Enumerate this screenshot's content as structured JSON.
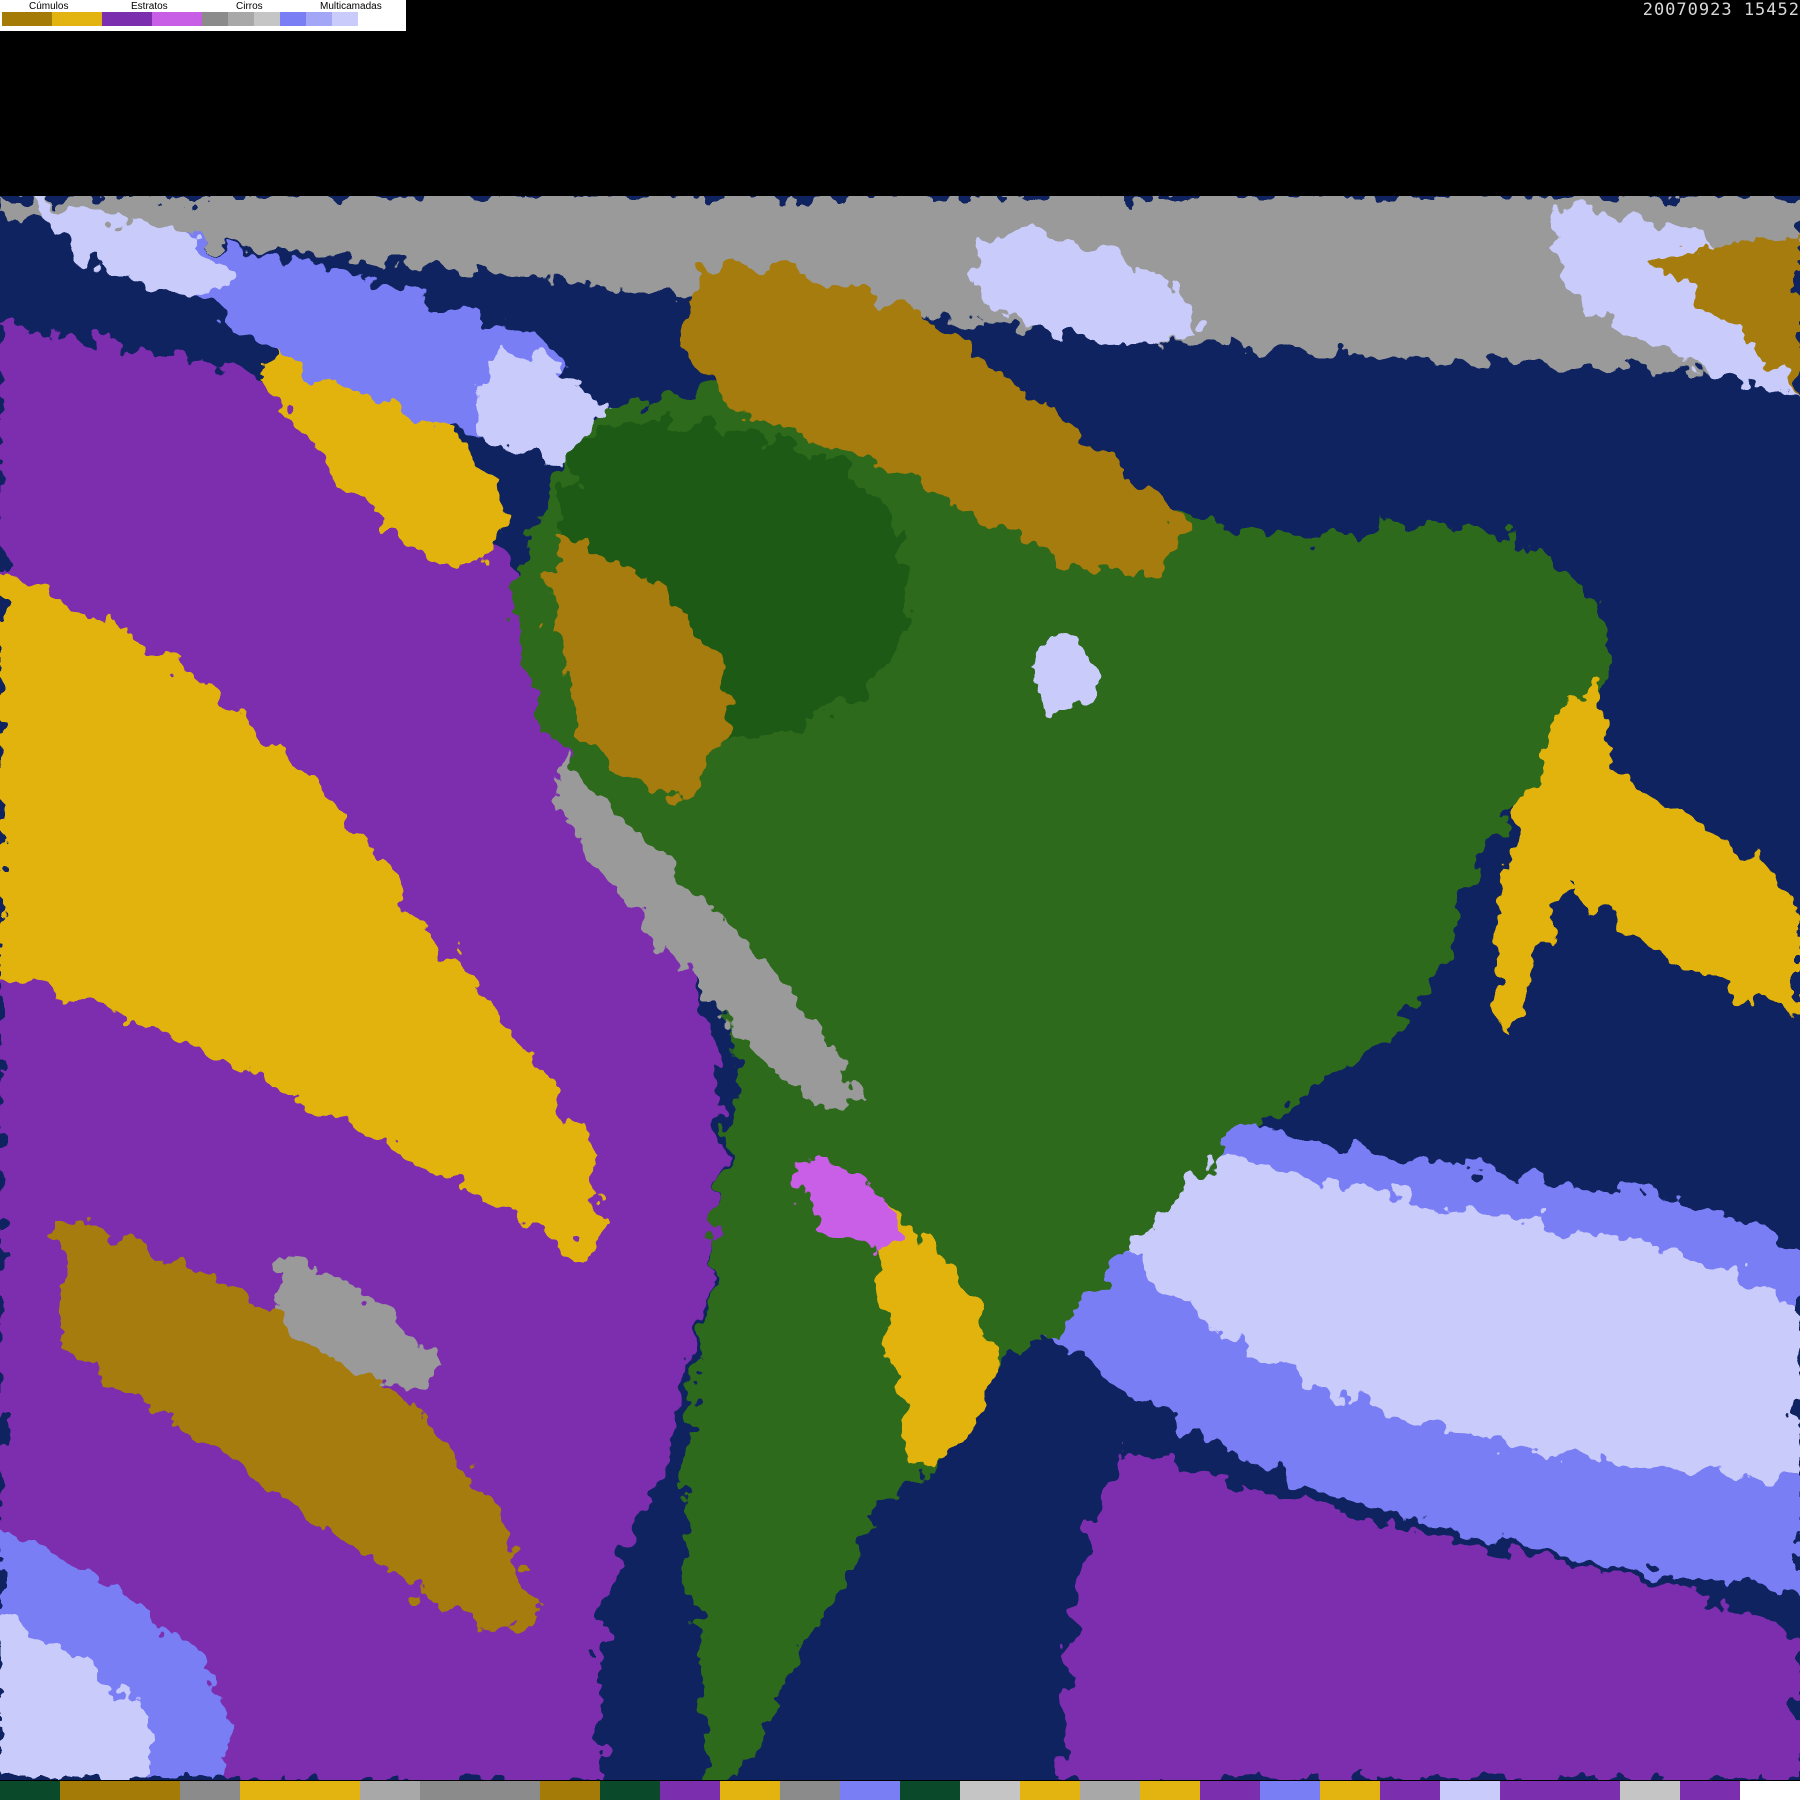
{
  "timestamp": "20070923 15452",
  "legend": {
    "groups": [
      {
        "label": "Cúmulos"
      },
      {
        "label": "Estratos"
      },
      {
        "label": "Cirros"
      },
      {
        "label": "Multicamadas"
      }
    ],
    "swatch_colors": [
      "#a57b07",
      "#e3b30f",
      "#7b2fae",
      "#c95ee6",
      "#8b8b8b",
      "#a8a8a8",
      "#c5c5c5",
      "#7a7ef4",
      "#a3a6f6",
      "#c9ccfb",
      "#ffffff"
    ]
  },
  "map_colors": {
    "ocean": "#0f2360",
    "land": "#2f6b1f",
    "land_dark": "#1d5a14",
    "cumulus_dark": "#a57b07",
    "cumulus": "#e3b30f",
    "stratus": "#7b2fae",
    "stratus_light": "#c95ee6",
    "cirrus": "#9a9a9a",
    "multilayer": "#7a7ef4",
    "multilayer_light": "#c9ccfb"
  },
  "bottom_strip_colors": [
    "#0a4a2a",
    "#a57b07",
    "#a57b07",
    "#8b8b8b",
    "#e3b30f",
    "#e3b30f",
    "#a8a8a8",
    "#8b8b8b",
    "#8b8b8b",
    "#a57b07",
    "#0a4a2a",
    "#7b2fae",
    "#e3b30f",
    "#8b8b8b",
    "#7a7ef4",
    "#0a4a2a",
    "#c5c5c5",
    "#e3b30f",
    "#a8a8a8",
    "#e3b30f",
    "#7b2fae",
    "#7a7ef4",
    "#e3b30f",
    "#7b2fae",
    "#c9ccfb",
    "#7b2fae",
    "#7b2fae",
    "#c5c5c5",
    "#7b2fae",
    "#ffffff"
  ]
}
